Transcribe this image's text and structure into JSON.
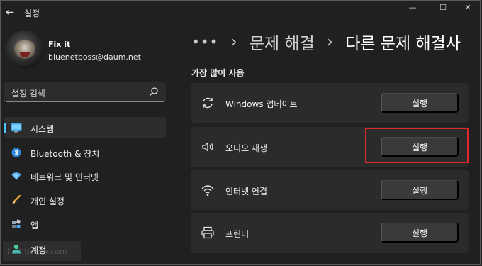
{
  "window": {
    "title": "설정",
    "back_icon": "←",
    "minimize_icon": "—",
    "maximize_icon": "☐",
    "close_icon": "✕"
  },
  "profile": {
    "name": "Fix it",
    "email": "bluenetboss@daum.net"
  },
  "search": {
    "placeholder": "설정 검색"
  },
  "sidebar": {
    "items": [
      {
        "label": "시스템",
        "icon": "system-monitor-icon",
        "active": true
      },
      {
        "label": "Bluetooth & 장치",
        "icon": "bluetooth-icon",
        "active": false
      },
      {
        "label": "네트워크 및 인터넷",
        "icon": "wifi-diamond-icon",
        "active": false
      },
      {
        "label": "개인 설정",
        "icon": "paintbrush-icon",
        "active": false
      },
      {
        "label": "앱",
        "icon": "apps-icon",
        "active": false
      },
      {
        "label": "계정",
        "icon": "account-icon",
        "active": false
      }
    ]
  },
  "watermark": {
    "text": "fixit.tistory.com"
  },
  "breadcrumb": {
    "ellipsis": "•••",
    "sep1": "›",
    "previous": "문제 해결",
    "sep2": "›",
    "current": "다른 문제 해결사"
  },
  "section": {
    "title": "가장 많이 사용"
  },
  "troubleshooters": [
    {
      "label": "Windows 업데이트",
      "icon": "refresh-icon",
      "button": "실행"
    },
    {
      "label": "오디오 재생",
      "icon": "speaker-icon",
      "button": "실행",
      "highlighted": true
    },
    {
      "label": "인터넷 연결",
      "icon": "wifi-icon",
      "button": "실행"
    },
    {
      "label": "프린터",
      "icon": "printer-icon",
      "button": "실행"
    }
  ],
  "colors": {
    "background": "#202020",
    "card": "#2b2b2b",
    "button": "#3a3a3a",
    "accent": "#4cc2ff",
    "highlight": "#e0282e"
  }
}
